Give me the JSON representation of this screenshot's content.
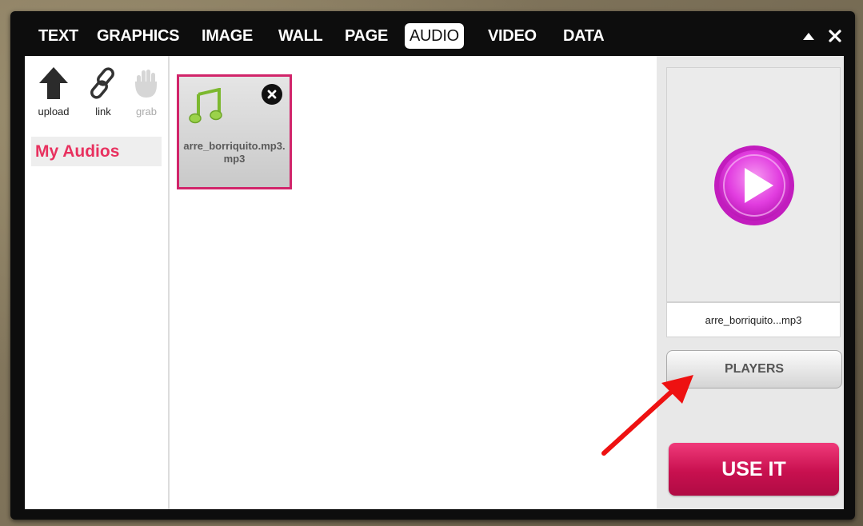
{
  "tabs": [
    {
      "label": "TEXT",
      "active": false
    },
    {
      "label": "GRAPHICS",
      "active": false
    },
    {
      "label": "IMAGE",
      "active": false
    },
    {
      "label": "WALL",
      "active": false
    },
    {
      "label": "PAGE",
      "active": false
    },
    {
      "label": "AUDIO",
      "active": true
    },
    {
      "label": "VIDEO",
      "active": false
    },
    {
      "label": "DATA",
      "active": false
    }
  ],
  "window_controls": {
    "collapse_icon": "triangle-up-icon",
    "close_icon": "close-icon"
  },
  "sources": [
    {
      "label": "upload",
      "icon": "upload-arrow-icon",
      "enabled": true
    },
    {
      "label": "link",
      "icon": "chain-link-icon",
      "enabled": true
    },
    {
      "label": "grab",
      "icon": "hand-icon",
      "enabled": false
    }
  ],
  "folder": {
    "label": "My Audios"
  },
  "files": [
    {
      "name": "arre_borriquito.mp3.mp3",
      "icon": "music-note-icon",
      "selected": true
    }
  ],
  "preview": {
    "caption": "arre_borriquito...mp3",
    "icon": "play-icon"
  },
  "buttons": {
    "players": "PLAYERS",
    "use_it": "USE IT"
  },
  "colors": {
    "accent": "#e8315f",
    "use_it": "#d0125a",
    "play": "#e23ee0",
    "note": "#8cc63f"
  }
}
